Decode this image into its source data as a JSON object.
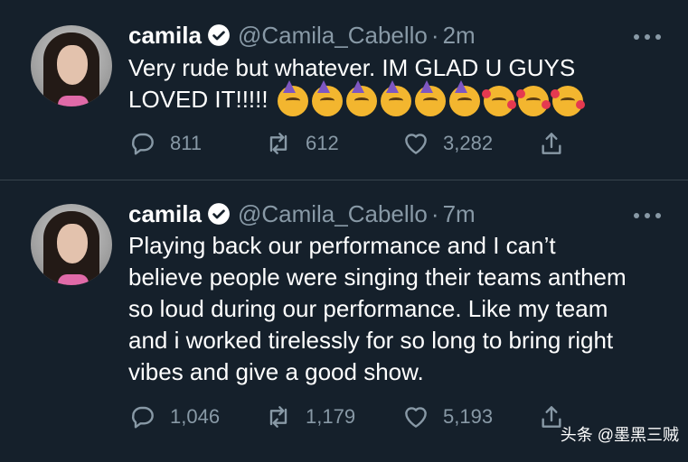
{
  "tweets": [
    {
      "name": "camila",
      "handle": "@Camila_Cabello",
      "separator": "·",
      "time": "2m",
      "text": "Very rude but whatever. IM GLAD U GUYS\nLOVED IT!!!!!",
      "emojis": [
        "partying-face-emoji",
        "partying-face-emoji",
        "partying-face-emoji",
        "partying-face-emoji",
        "partying-face-emoji",
        "partying-face-emoji",
        "smiling-face-with-hearts-emoji",
        "smiling-face-with-hearts-emoji",
        "smiling-face-with-hearts-emoji"
      ],
      "replies": "811",
      "retweets": "612",
      "likes": "3,282"
    },
    {
      "name": "camila",
      "handle": "@Camila_Cabello",
      "separator": "·",
      "time": "7m",
      "text": "Playing back our performance and I can’t\nbelieve people were singing their teams anthem\nso loud during our performance. Like my team\nand i worked tirelessly for so long to bring right\nvibes and give a good show.",
      "replies": "1,046",
      "retweets": "1,179",
      "likes": "5,193"
    }
  ],
  "watermark": "头条 @墨黑三贼",
  "colors": {
    "background": "#15202b",
    "divider": "#38444d",
    "secondary_text": "#8899a6",
    "primary_text": "#ffffff"
  }
}
